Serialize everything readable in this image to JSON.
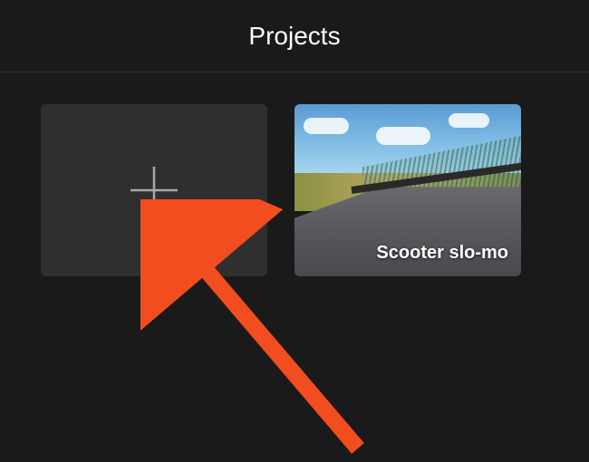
{
  "header": {
    "title": "Projects"
  },
  "projects": [
    {
      "type": "new",
      "icon": "plus-icon"
    },
    {
      "type": "project",
      "label": "Scooter slo-mo"
    }
  ],
  "annotation": {
    "type": "arrow",
    "color": "#f24d1f",
    "target": "new-project-tile"
  }
}
